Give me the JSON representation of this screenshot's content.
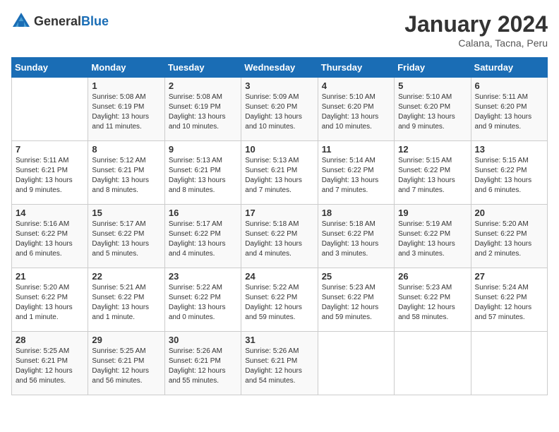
{
  "header": {
    "logo": {
      "text_general": "General",
      "text_blue": "Blue"
    },
    "title": "January 2024",
    "subtitle": "Calana, Tacna, Peru"
  },
  "days_of_week": [
    "Sunday",
    "Monday",
    "Tuesday",
    "Wednesday",
    "Thursday",
    "Friday",
    "Saturday"
  ],
  "weeks": [
    {
      "days": [
        {
          "num": "",
          "info": ""
        },
        {
          "num": "1",
          "info": "Sunrise: 5:08 AM\nSunset: 6:19 PM\nDaylight: 13 hours\nand 11 minutes."
        },
        {
          "num": "2",
          "info": "Sunrise: 5:08 AM\nSunset: 6:19 PM\nDaylight: 13 hours\nand 10 minutes."
        },
        {
          "num": "3",
          "info": "Sunrise: 5:09 AM\nSunset: 6:20 PM\nDaylight: 13 hours\nand 10 minutes."
        },
        {
          "num": "4",
          "info": "Sunrise: 5:10 AM\nSunset: 6:20 PM\nDaylight: 13 hours\nand 10 minutes."
        },
        {
          "num": "5",
          "info": "Sunrise: 5:10 AM\nSunset: 6:20 PM\nDaylight: 13 hours\nand 9 minutes."
        },
        {
          "num": "6",
          "info": "Sunrise: 5:11 AM\nSunset: 6:20 PM\nDaylight: 13 hours\nand 9 minutes."
        }
      ]
    },
    {
      "days": [
        {
          "num": "7",
          "info": "Sunrise: 5:11 AM\nSunset: 6:21 PM\nDaylight: 13 hours\nand 9 minutes."
        },
        {
          "num": "8",
          "info": "Sunrise: 5:12 AM\nSunset: 6:21 PM\nDaylight: 13 hours\nand 8 minutes."
        },
        {
          "num": "9",
          "info": "Sunrise: 5:13 AM\nSunset: 6:21 PM\nDaylight: 13 hours\nand 8 minutes."
        },
        {
          "num": "10",
          "info": "Sunrise: 5:13 AM\nSunset: 6:21 PM\nDaylight: 13 hours\nand 7 minutes."
        },
        {
          "num": "11",
          "info": "Sunrise: 5:14 AM\nSunset: 6:22 PM\nDaylight: 13 hours\nand 7 minutes."
        },
        {
          "num": "12",
          "info": "Sunrise: 5:15 AM\nSunset: 6:22 PM\nDaylight: 13 hours\nand 7 minutes."
        },
        {
          "num": "13",
          "info": "Sunrise: 5:15 AM\nSunset: 6:22 PM\nDaylight: 13 hours\nand 6 minutes."
        }
      ]
    },
    {
      "days": [
        {
          "num": "14",
          "info": "Sunrise: 5:16 AM\nSunset: 6:22 PM\nDaylight: 13 hours\nand 6 minutes."
        },
        {
          "num": "15",
          "info": "Sunrise: 5:17 AM\nSunset: 6:22 PM\nDaylight: 13 hours\nand 5 minutes."
        },
        {
          "num": "16",
          "info": "Sunrise: 5:17 AM\nSunset: 6:22 PM\nDaylight: 13 hours\nand 4 minutes."
        },
        {
          "num": "17",
          "info": "Sunrise: 5:18 AM\nSunset: 6:22 PM\nDaylight: 13 hours\nand 4 minutes."
        },
        {
          "num": "18",
          "info": "Sunrise: 5:18 AM\nSunset: 6:22 PM\nDaylight: 13 hours\nand 3 minutes."
        },
        {
          "num": "19",
          "info": "Sunrise: 5:19 AM\nSunset: 6:22 PM\nDaylight: 13 hours\nand 3 minutes."
        },
        {
          "num": "20",
          "info": "Sunrise: 5:20 AM\nSunset: 6:22 PM\nDaylight: 13 hours\nand 2 minutes."
        }
      ]
    },
    {
      "days": [
        {
          "num": "21",
          "info": "Sunrise: 5:20 AM\nSunset: 6:22 PM\nDaylight: 13 hours\nand 1 minute."
        },
        {
          "num": "22",
          "info": "Sunrise: 5:21 AM\nSunset: 6:22 PM\nDaylight: 13 hours\nand 1 minute."
        },
        {
          "num": "23",
          "info": "Sunrise: 5:22 AM\nSunset: 6:22 PM\nDaylight: 13 hours\nand 0 minutes."
        },
        {
          "num": "24",
          "info": "Sunrise: 5:22 AM\nSunset: 6:22 PM\nDaylight: 12 hours\nand 59 minutes."
        },
        {
          "num": "25",
          "info": "Sunrise: 5:23 AM\nSunset: 6:22 PM\nDaylight: 12 hours\nand 59 minutes."
        },
        {
          "num": "26",
          "info": "Sunrise: 5:23 AM\nSunset: 6:22 PM\nDaylight: 12 hours\nand 58 minutes."
        },
        {
          "num": "27",
          "info": "Sunrise: 5:24 AM\nSunset: 6:22 PM\nDaylight: 12 hours\nand 57 minutes."
        }
      ]
    },
    {
      "days": [
        {
          "num": "28",
          "info": "Sunrise: 5:25 AM\nSunset: 6:21 PM\nDaylight: 12 hours\nand 56 minutes."
        },
        {
          "num": "29",
          "info": "Sunrise: 5:25 AM\nSunset: 6:21 PM\nDaylight: 12 hours\nand 56 minutes."
        },
        {
          "num": "30",
          "info": "Sunrise: 5:26 AM\nSunset: 6:21 PM\nDaylight: 12 hours\nand 55 minutes."
        },
        {
          "num": "31",
          "info": "Sunrise: 5:26 AM\nSunset: 6:21 PM\nDaylight: 12 hours\nand 54 minutes."
        },
        {
          "num": "",
          "info": ""
        },
        {
          "num": "",
          "info": ""
        },
        {
          "num": "",
          "info": ""
        }
      ]
    }
  ]
}
